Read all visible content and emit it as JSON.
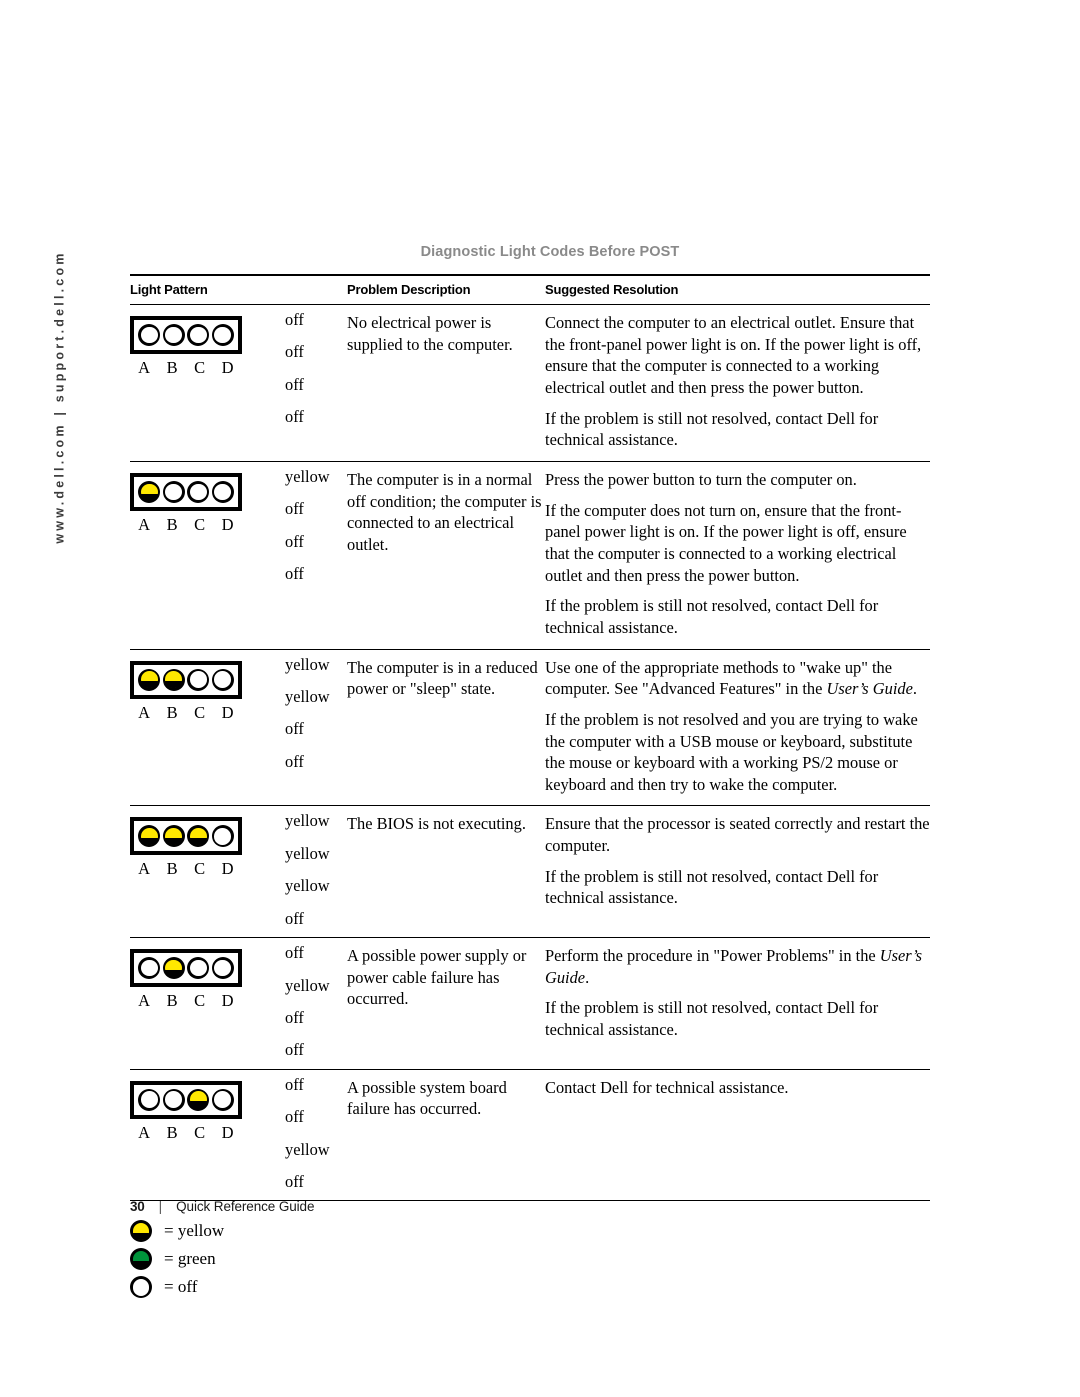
{
  "side_url": "www.dell.com | support.dell.com",
  "table": {
    "title": "Diagnostic Light Codes Before POST",
    "headers": {
      "pattern": "Light Pattern",
      "problem": "Problem Description",
      "resolution": "Suggested Resolution"
    },
    "led_labels": [
      "A",
      "B",
      "C",
      "D"
    ],
    "rows": [
      {
        "lights": [
          "off",
          "off",
          "off",
          "off"
        ],
        "states": [
          "off",
          "off",
          "off",
          "off"
        ],
        "problem": [
          "No electrical power is supplied to the computer."
        ],
        "resolution_html": [
          "Connect the computer to an electrical outlet. Ensure that the front-panel power light is on. If the power light is off, ensure that the computer is connected to a working electrical outlet and then press the power button.",
          "If the problem is still not resolved, contact Dell for technical assistance."
        ]
      },
      {
        "lights": [
          "yellow",
          "off",
          "off",
          "off"
        ],
        "states": [
          "yellow",
          "off",
          "off",
          "off"
        ],
        "problem": [
          "The computer is in a normal off condition; the computer is connected to an electrical outlet."
        ],
        "resolution_html": [
          "Press the power button to turn the computer on.",
          "If the computer does not turn on, ensure that the front-panel power light is on. If the power light is off, ensure that the computer is connected to a working electrical outlet and then press the power button.",
          "If the problem is still not resolved, contact Dell for technical assistance."
        ]
      },
      {
        "lights": [
          "yellow",
          "yellow",
          "off",
          "off"
        ],
        "states": [
          "yellow",
          "yellow",
          "off",
          "off"
        ],
        "problem": [
          "The computer is in a reduced power or \"sleep\" state."
        ],
        "resolution_html": [
          "Use one of the appropriate methods to \"wake up\" the computer. See \"Advanced Features\" in the <i>User’s Guide</i>.",
          "If the problem is not resolved and you are trying to wake the computer with a USB mouse or keyboard, substitute the mouse or keyboard with a working PS/2 mouse or keyboard and then try to wake the computer."
        ]
      },
      {
        "lights": [
          "yellow",
          "yellow",
          "yellow",
          "off"
        ],
        "states": [
          "yellow",
          "yellow",
          "yellow",
          "off"
        ],
        "problem": [
          "The BIOS is not executing."
        ],
        "resolution_html": [
          "Ensure that the processor is seated correctly and restart the computer.",
          "If the problem is still not resolved, contact Dell for technical assistance."
        ]
      },
      {
        "lights": [
          "off",
          "yellow",
          "off",
          "off"
        ],
        "states": [
          "off",
          "yellow",
          "off",
          "off"
        ],
        "problem": [
          "A possible power supply or power cable failure has occurred."
        ],
        "resolution_html": [
          "Perform the procedure in \"Power Problems\" in the <i>User’s Guide</i>.",
          "If the problem is still not resolved, contact Dell for technical assistance."
        ]
      },
      {
        "lights": [
          "off",
          "off",
          "yellow",
          "off"
        ],
        "states": [
          "off",
          "off",
          "yellow",
          "off"
        ],
        "problem": [
          "A possible system board failure has occurred."
        ],
        "resolution_html": [
          "Contact Dell for technical assistance."
        ]
      }
    ]
  },
  "legend": [
    {
      "light": "yellow",
      "label": "= yellow"
    },
    {
      "light": "green",
      "label": "= green"
    },
    {
      "light": "off",
      "label": "= off"
    }
  ],
  "footer": {
    "page_number": "30",
    "separator": "|",
    "document_name": "Quick Reference Guide"
  },
  "colors": {
    "yellow": "#ffe800",
    "green": "#00933b",
    "off": "#ffffff",
    "title_gray": "#8a8a8a"
  }
}
